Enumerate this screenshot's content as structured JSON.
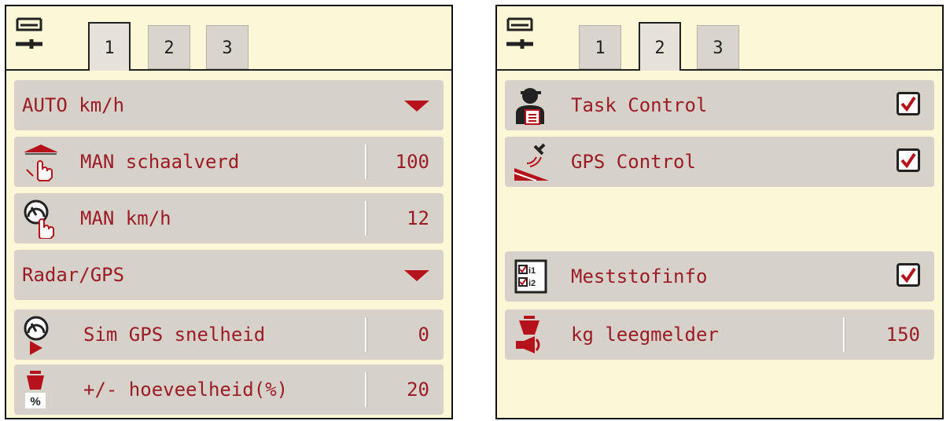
{
  "left_panel": {
    "tabs": [
      "1",
      "2",
      "3"
    ],
    "active_tab": "1",
    "rows": {
      "auto_speed": {
        "label": "AUTO km/h"
      },
      "man_scale": {
        "label": "MAN schaalverd",
        "value": "100"
      },
      "man_speed": {
        "label": "MAN km/h",
        "value": "12"
      },
      "radar_gps": {
        "label": "Radar/GPS"
      },
      "sim_gps": {
        "label": "Sim GPS snelheid",
        "value": "0"
      },
      "quantity": {
        "label": "+/- hoeveelheid(%)",
        "value": "20"
      }
    }
  },
  "right_panel": {
    "tabs": [
      "1",
      "2",
      "3"
    ],
    "active_tab": "2",
    "rows": {
      "task_control": {
        "label": "Task Control",
        "checked": true
      },
      "gps_control": {
        "label": "GPS Control",
        "checked": true
      },
      "fertilizer_info": {
        "label": "Meststofinfo",
        "checked": true,
        "icon_text": [
          "i1",
          "i2"
        ]
      },
      "empty_alarm": {
        "label": "kg leegmelder",
        "value": "150"
      }
    }
  },
  "colors": {
    "accent_red": "#9b1b26",
    "background": "#fbf8d8",
    "row_gray": "#d7d2c9"
  },
  "icons": [
    "settings-wrench-icon",
    "dropdown-arrow-icon",
    "hand-scale-icon",
    "hand-speedometer-icon",
    "speedometer-sim-icon",
    "quantity-percent-icon",
    "operator-icon",
    "gps-control-icon",
    "fertilizer-info-icon",
    "hopper-alarm-icon",
    "checkbox-checked-icon"
  ]
}
